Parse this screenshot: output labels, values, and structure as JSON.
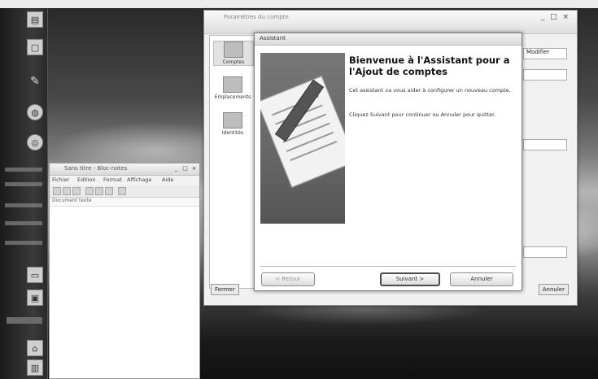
{
  "desktop": {
    "top_strip": ""
  },
  "taskbar": {
    "icons": [
      "document-icon",
      "window-icon",
      "tools-icon",
      "globe-icon",
      "disc-icon",
      "folder-icon",
      "monitor-icon",
      "chart-icon",
      "computer-icon",
      "trash-icon"
    ]
  },
  "notepad": {
    "title": "Sans titre - Bloc-notes",
    "menu": [
      "Fichier",
      "Edition",
      "Format",
      "Affichage",
      "Aide"
    ],
    "path": "Document texte",
    "controls": [
      "_",
      "□",
      "×"
    ]
  },
  "settings": {
    "title": "Paramètres du compte",
    "controls": "_ □ ×",
    "sub_controls": "",
    "sidebar": [
      {
        "label": "Comptes"
      },
      {
        "label": "Emplacements"
      },
      {
        "label": "Identités"
      }
    ],
    "right_field": "Modifier",
    "bottom_left": "Fermer",
    "bottom_right": "Annuler"
  },
  "wizard": {
    "title": "Assistant",
    "heading": "Bienvenue à l'Assistant pour a l'Ajout de comptes",
    "text1": "Cet assistant va vous aider à configurer un nouveau compte.",
    "text2": "Cliquez Suivant pour continuer ou Annuler pour quitter.",
    "buttons": {
      "back": "< Retour",
      "next": "Suivant >",
      "cancel": "Annuler"
    }
  }
}
